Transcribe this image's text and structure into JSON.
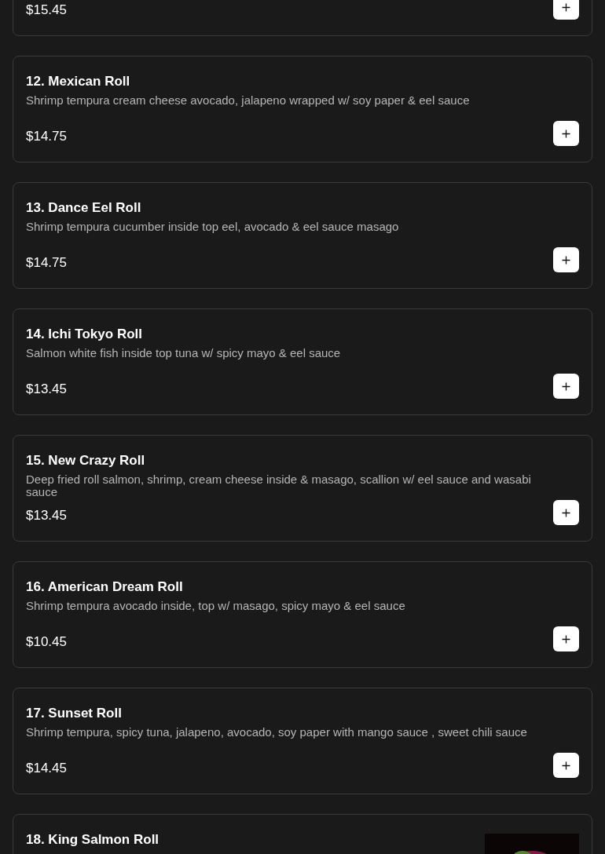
{
  "items": [
    {
      "price": "$15.45"
    },
    {
      "title": "12. Mexican Roll",
      "description": "Shrimp tempura cream cheese avocado, jalapeno wrapped w/ soy paper & eel sauce",
      "price": "$14.75"
    },
    {
      "title": "13. Dance Eel Roll",
      "description": "Shrimp tempura cucumber inside top eel, avocado & eel sauce masago",
      "price": "$14.75"
    },
    {
      "title": "14. Ichi Tokyo Roll",
      "description": "Salmon white fish inside top tuna w/ spicy mayo & eel sauce",
      "price": "$13.45"
    },
    {
      "title": "15. New Crazy Roll",
      "description": "Deep fried roll salmon, shrimp, cream cheese inside & masago, scallion w/ eel sauce and wasabi sauce",
      "price": "$13.45"
    },
    {
      "title": "16. American Dream Roll",
      "description": "Shrimp tempura avocado inside, top w/ masago, spicy mayo & eel sauce",
      "price": "$10.45"
    },
    {
      "title": "17. Sunset Roll",
      "description": "Shrimp tempura, spicy tuna, jalapeno, avocado, soy paper with mango sauce , sweet chili sauce",
      "price": "$14.45"
    },
    {
      "title": "18. King Salmon Roll",
      "kind": "picture"
    }
  ]
}
